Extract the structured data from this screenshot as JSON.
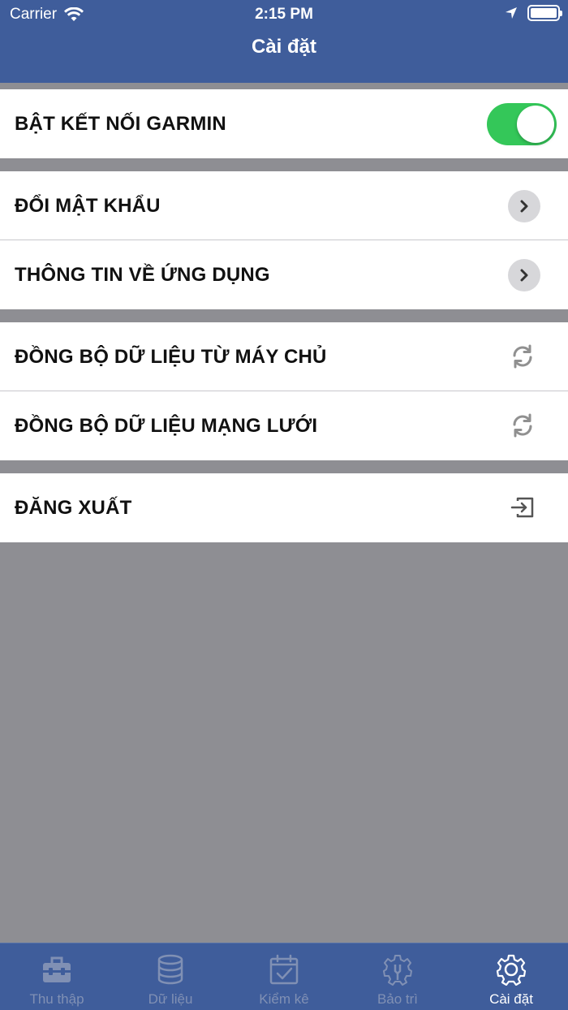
{
  "status_bar": {
    "carrier": "Carrier",
    "time": "2:15 PM"
  },
  "header": {
    "title": "Cài đặt"
  },
  "settings": {
    "garmin": {
      "label": "BẬT KẾT NỐI GARMIN",
      "enabled": true
    },
    "change_password": {
      "label": "ĐỔI MẬT KHẨU"
    },
    "app_info": {
      "label": "THÔNG TIN VỀ ỨNG DỤNG"
    },
    "sync_server": {
      "label": "ĐỒNG BỘ DỮ LIỆU TỪ MÁY CHỦ"
    },
    "sync_network": {
      "label": "ĐỒNG BỘ DỮ LIỆU MẠNG LƯỚI"
    },
    "logout": {
      "label": "ĐĂNG XUẤT"
    }
  },
  "tabbar": {
    "tabs": [
      {
        "label": "Thu thập",
        "icon": "toolbox-icon"
      },
      {
        "label": "Dữ liệu",
        "icon": "database-icon"
      },
      {
        "label": "Kiểm kê",
        "icon": "calendar-check-icon"
      },
      {
        "label": "Bảo trì",
        "icon": "gear-wrench-icon"
      },
      {
        "label": "Cài đặt",
        "icon": "gear-icon"
      }
    ],
    "active_index": 4
  },
  "colors": {
    "header": "#3f5d9b",
    "background": "#8e8e93",
    "toggle_on": "#34c759",
    "tab_inactive": "#8090b4",
    "tab_active": "#ffffff"
  }
}
